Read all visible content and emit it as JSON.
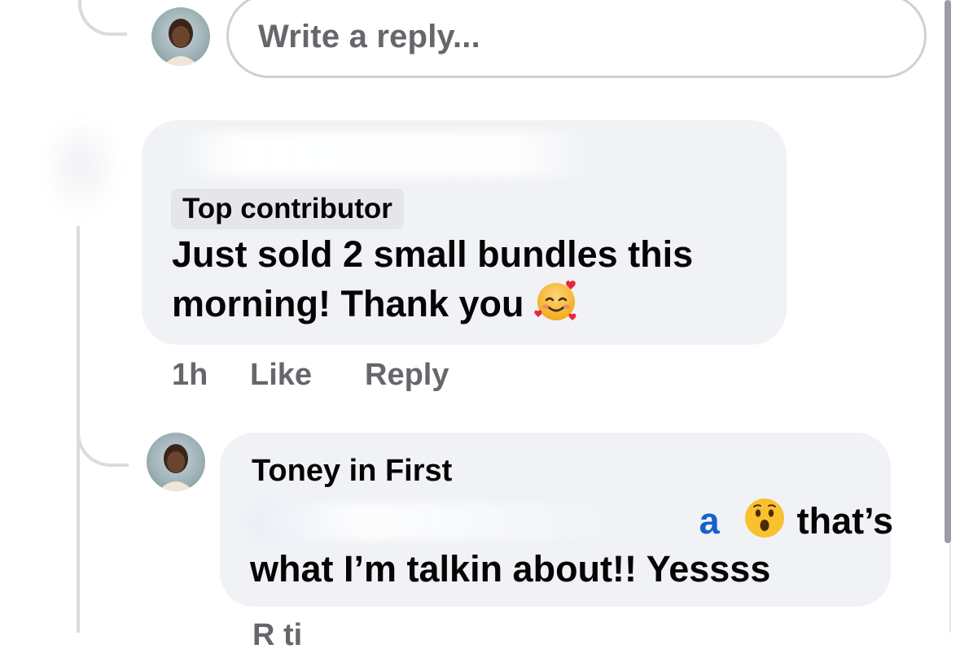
{
  "composer": {
    "placeholder": "Write a reply..."
  },
  "comment": {
    "badge": "Top contributor",
    "text": "Just sold 2 small bundles this morning! Thank you",
    "emoji_icon": "smiling-face-with-hearts-icon",
    "time": "1h",
    "like_label": "Like",
    "reply_label": "Reply"
  },
  "reply": {
    "author": "Toney in First",
    "mention_tail": "a",
    "emoji_icon": "face-with-open-mouth-icon",
    "line1_rest": " that’s",
    "line2": "what I’m talkin about!! Yessss"
  },
  "truncated": {
    "text": "R    ti"
  },
  "colors": {
    "bubble": "#f0f2f5",
    "secondary_text": "#65676b",
    "mention": "#1461c9",
    "badge_bg": "#e4e6eb"
  }
}
